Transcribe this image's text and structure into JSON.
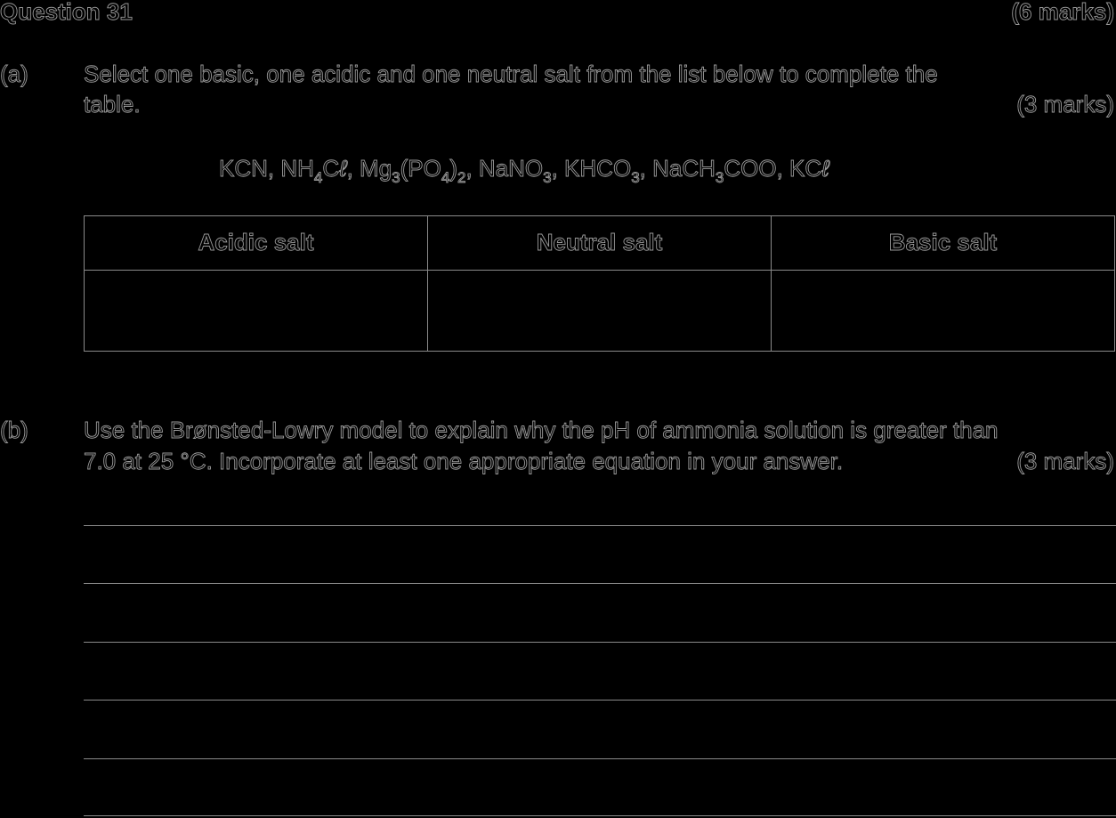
{
  "question": {
    "title": "Question 31",
    "marks": "(6 marks)"
  },
  "part_a": {
    "label": "(a)",
    "text_line1": "Select one basic, one acidic and one neutral salt from the list below to complete the",
    "text_line2": "table.",
    "marks": "(3 marks)",
    "salts": {
      "s1": "KCN, NH",
      "s1_sub": "4",
      "s2": "C",
      "s2_ell": "ℓ",
      "s3": ", Mg",
      "s3_sub": "3",
      "s4": "(PO",
      "s4_sub1": "4",
      "s4_close": ")",
      "s4_sub2": "2",
      "s5": ", NaNO",
      "s5_sub": "3",
      "s6": ", KHCO",
      "s6_sub": "3",
      "s7": ", NaCH",
      "s7_sub": "3",
      "s8": "COO, KC",
      "s8_ell": "ℓ"
    },
    "table": {
      "headers": [
        "Acidic salt",
        "Neutral salt",
        "Basic salt"
      ],
      "row": [
        "",
        "",
        ""
      ]
    }
  },
  "part_b": {
    "label": "(b)",
    "text_line1": "Use the Brønsted-Lowry model to explain why the pH of ammonia solution is greater than",
    "text_line2": "7.0 at 25 °C. Incorporate at least one appropriate equation in your answer.",
    "marks": "(3 marks)",
    "answer_lines": 6
  }
}
